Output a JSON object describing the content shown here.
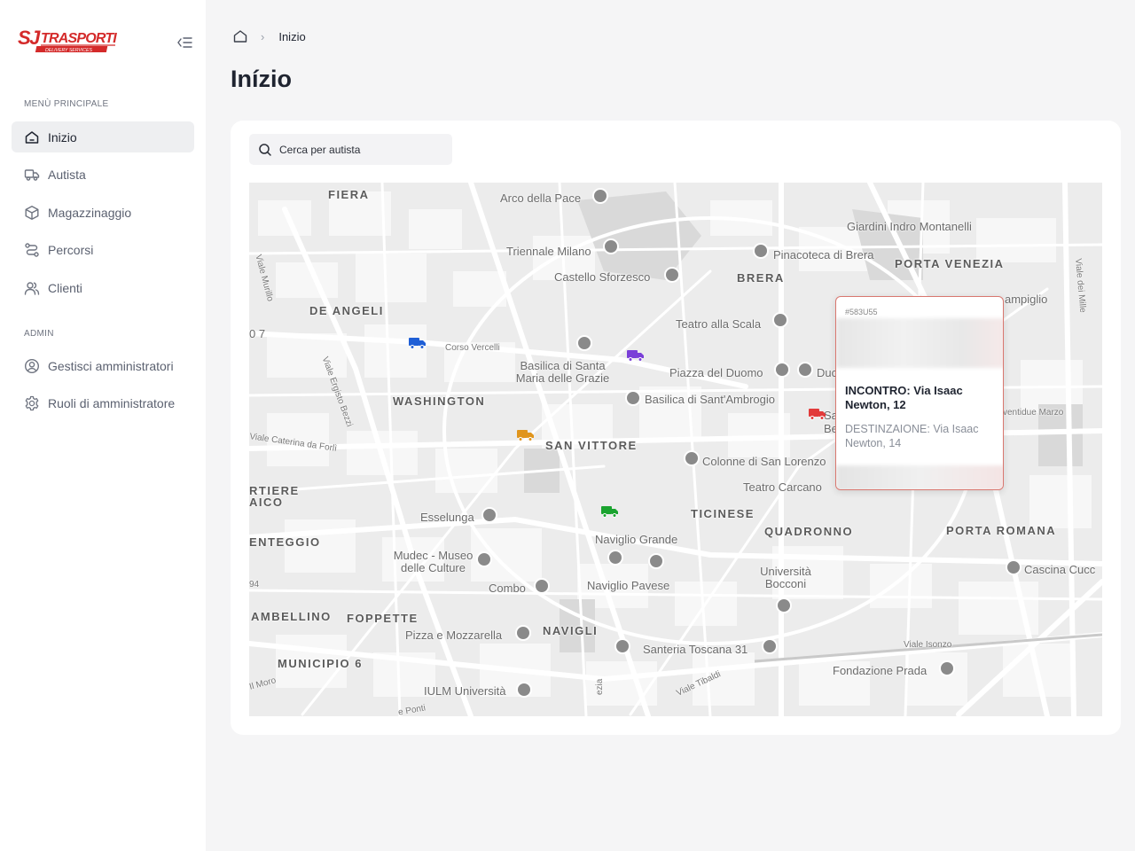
{
  "brand": {
    "name": "SJTRASPORTI",
    "tagline": "DELIVERY SERVICES",
    "color": "#d42a2a"
  },
  "sidebar": {
    "main_section": "MENÙ PRINCIPALE",
    "admin_section": "ADMIN",
    "items": [
      {
        "label": "Inizio",
        "icon": "home-icon",
        "active": true
      },
      {
        "label": "Autista",
        "icon": "truck-icon"
      },
      {
        "label": "Magazzinaggio",
        "icon": "box-icon"
      },
      {
        "label": "Percorsi",
        "icon": "route-icon"
      },
      {
        "label": "Clienti",
        "icon": "users-icon"
      }
    ],
    "admin_items": [
      {
        "label": "Gestisci amministratori",
        "icon": "user-circle-icon"
      },
      {
        "label": "Ruoli di amministratore",
        "icon": "gear-icon"
      }
    ]
  },
  "breadcrumb": {
    "current": "Inizio"
  },
  "page": {
    "title": "Inízio"
  },
  "search": {
    "placeholder": "Cerca per autista"
  },
  "map": {
    "labels": [
      "FIERA",
      "Arco della Pace",
      "Giardini Indro Montanelli",
      "Triennale Milano",
      "Pinacoteca di Brera",
      "PORTA VENEZIA",
      "Castello Sforzesco",
      "BRERA",
      "DE ANGELI",
      "Corso Vercelli",
      "Teatro alla Scala",
      "Basilica di Santa Maria delle Grazie",
      "Piazza del Duomo",
      "WASHINGTON",
      "Basilica di Sant'Ambrogio",
      "SAN VITTORE",
      "Colonne di San Lorenzo",
      "Teatro Carcano",
      "TICINESE",
      "Esselunga",
      "Naviglio Grande",
      "QUADRONNO",
      "PORTA ROMANA",
      "ENTEGGIO",
      "Mudec - Museo delle Culture",
      "Università Bocconi",
      "Cascina Cucc",
      "Combo",
      "Naviglio Pavese",
      "AMBELLINO",
      "FOPPETTE",
      "Pizza e Mozzarella",
      "NAVIGLI",
      "Santeria Toscana 31",
      "Viale Isonzo",
      "MUNICIPIO 6",
      "Fondazione Prada",
      "IULM Università",
      "Viale Tibaldi",
      "Viale Murillo",
      "Viale Ergisto Bezzi",
      "Viale dei Mille",
      "Duc",
      "Be",
      "Sa",
      "RTIERE",
      "AICO",
      "0 7",
      "Viale Caterina da Forlì",
      "ampiglio",
      "ventidue Marzo",
      "Il Moro",
      "ezia",
      "94",
      "e Ponti"
    ],
    "trucks": [
      {
        "name": "truck-blue",
        "color": "#1f5fd6"
      },
      {
        "name": "truck-purple",
        "color": "#7a3fd8"
      },
      {
        "name": "truck-orange",
        "color": "#e0951c"
      },
      {
        "name": "truck-green",
        "color": "#1aa32f"
      },
      {
        "name": "truck-red",
        "color": "#e23a3a"
      }
    ],
    "popup": {
      "code": "#583U55",
      "pickup": "INCONTRO: Via Isaac Newton, 12",
      "destination": "DESTINZAIONE: Via Isaac Newton, 14"
    }
  }
}
